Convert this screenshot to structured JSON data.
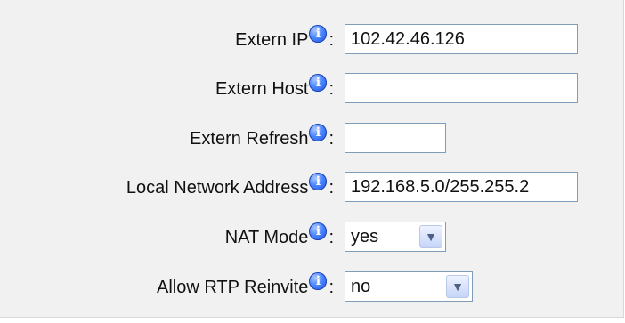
{
  "fields": [
    {
      "label": "Extern IP",
      "value": "102.42.46.126",
      "type": "text"
    },
    {
      "label": "Extern Host",
      "value": "",
      "type": "text"
    },
    {
      "label": "Extern Refresh",
      "value": "",
      "type": "text"
    },
    {
      "label": "Local Network Address",
      "value": "192.168.5.0/255.255.2",
      "type": "text"
    },
    {
      "label": "NAT Mode",
      "value": "yes",
      "type": "select"
    },
    {
      "label": "Allow RTP Reinvite",
      "value": "no",
      "type": "select"
    }
  ],
  "colon": ":",
  "icons": {
    "info": "info-icon",
    "dropdown": "chevron-down-icon"
  },
  "colors": {
    "panel_bg": "#f1f1f1",
    "input_border": "#7f9db9",
    "info_blue": "#1f4fd8"
  }
}
